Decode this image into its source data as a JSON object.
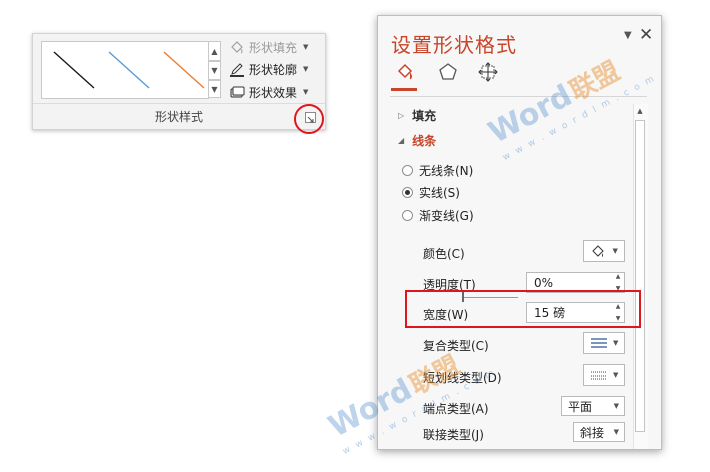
{
  "ribbon": {
    "group_label": "形状样式",
    "buttons": {
      "fill": "形状填充",
      "outline": "形状轮廓",
      "effects": "形状效果"
    },
    "gallery_colors": [
      "#1a1a1a",
      "#5b9bd5",
      "#ed7d31"
    ]
  },
  "pane": {
    "title": "设置形状格式",
    "sections": {
      "fill": "填充",
      "line": "线条"
    },
    "radio_options": [
      {
        "label": "无线条(N)",
        "selected": false
      },
      {
        "label": "实线(S)",
        "selected": true
      },
      {
        "label": "渐变线(G)",
        "selected": false
      }
    ],
    "props": {
      "color_label": "颜色(C)",
      "transparency_label": "透明度(T)",
      "transparency_value": "0%",
      "width_label": "宽度(W)",
      "width_value": "15 磅",
      "compound_label": "复合类型(C)",
      "dash_label": "短划线类型(D)",
      "cap_label": "端点类型(A)",
      "cap_value": "平面",
      "join_label": "联接类型(J)",
      "join_value": "斜接"
    }
  },
  "watermark": {
    "brand": "Word",
    "brand_cn": "联盟",
    "url": "w w w . w o r d l m . c o m"
  },
  "colors": {
    "accent": "#c8452a",
    "highlight": "#e0161c"
  }
}
